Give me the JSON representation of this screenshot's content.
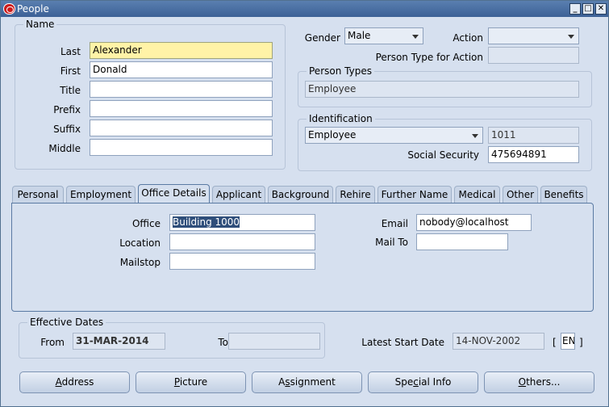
{
  "window": {
    "title": "People"
  },
  "name_group": {
    "legend": "Name",
    "last_label": "Last",
    "last_value": "Alexander",
    "first_label": "First",
    "first_value": "Donald",
    "title_label": "Title",
    "prefix_label": "Prefix",
    "suffix_label": "Suffix",
    "middle_label": "Middle"
  },
  "gender": {
    "label": "Gender",
    "value": "Male"
  },
  "action": {
    "label": "Action",
    "value": "",
    "type_label": "Person Type for Action"
  },
  "person_types": {
    "legend": "Person Types",
    "value": "Employee"
  },
  "identification": {
    "legend": "Identification",
    "type": "Employee",
    "number": "1011",
    "ss_label": "Social Security",
    "ss_value": "475694891"
  },
  "tabs": [
    "Personal",
    "Employment",
    "Office Details",
    "Applicant",
    "Background",
    "Rehire",
    "Further Name",
    "Medical",
    "Other",
    "Benefits"
  ],
  "office": {
    "office_label": "Office",
    "office_value": "Building 1000",
    "location_label": "Location",
    "mailstop_label": "Mailstop",
    "email_label": "Email",
    "email_value": "nobody@localhost",
    "mailto_label": "Mail To"
  },
  "effective": {
    "legend": "Effective Dates",
    "from_label": "From",
    "from_value": "31-MAR-2014",
    "to_label": "To"
  },
  "latest": {
    "label": "Latest Start Date",
    "value": "14-NOV-2002",
    "lang": "EN",
    "bracket_open": "[",
    "bracket_close": "]"
  },
  "buttons": {
    "address_first": "A",
    "address_rest": "ddress",
    "picture_first": "P",
    "picture_rest": "icture",
    "assignment_pre": "A",
    "assignment_u": "s",
    "assignment_rest": "signment",
    "special_pre": "Spe",
    "special_u": "c",
    "special_rest": "ial Info",
    "others_first": "O",
    "others_rest": "thers..."
  }
}
